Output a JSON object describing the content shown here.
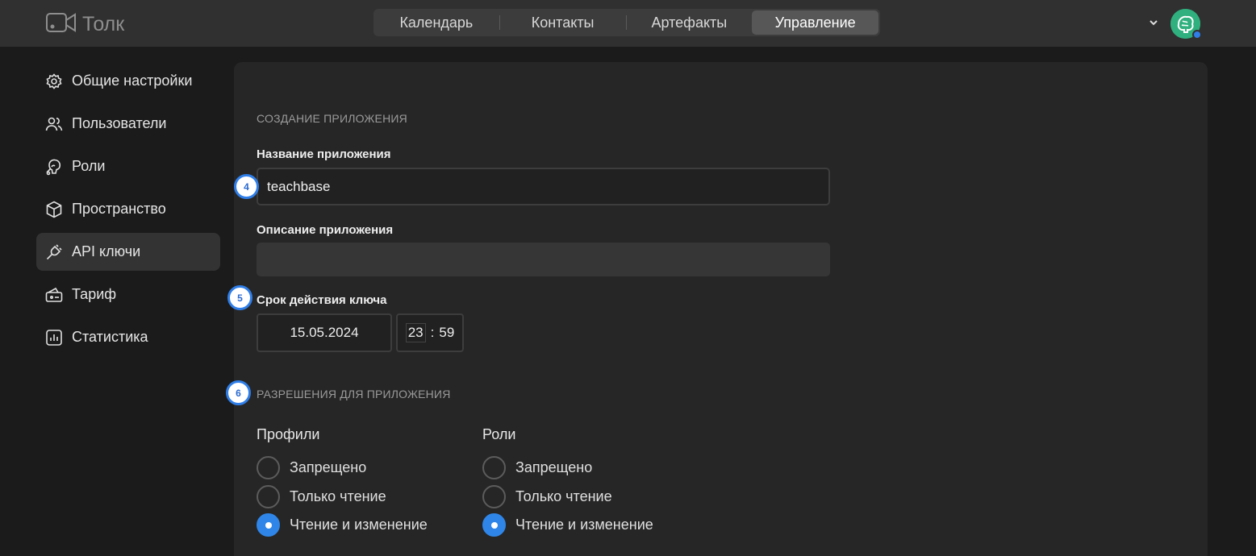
{
  "app": {
    "name": "Толк"
  },
  "nav_tabs": [
    {
      "label": "Календарь"
    },
    {
      "label": "Контакты"
    },
    {
      "label": "Артефакты"
    },
    {
      "label": "Управление"
    }
  ],
  "active_tab": "Управление",
  "sidebar": {
    "items": [
      {
        "label": "Общие настройки",
        "icon": "gear-icon"
      },
      {
        "label": "Пользователи",
        "icon": "users-icon"
      },
      {
        "label": "Роли",
        "icon": "roles-icon"
      },
      {
        "label": "Пространство",
        "icon": "cube-icon"
      },
      {
        "label": "API ключи",
        "icon": "plug-icon"
      },
      {
        "label": "Тариф",
        "icon": "tariff-icon"
      },
      {
        "label": "Статистика",
        "icon": "stats-icon"
      }
    ],
    "active": "API ключи"
  },
  "form": {
    "section_title": "СОЗДАНИЕ ПРИЛОЖЕНИЯ",
    "app_name_label": "Название приложения",
    "app_name_value": "teachbase",
    "app_desc_label": "Описание приложения",
    "app_desc_value": "",
    "expiry_label": "Срок действия ключа",
    "expiry_date": "15.05.2024",
    "expiry_hours": "23",
    "expiry_sep": ":",
    "expiry_minutes": "59",
    "permissions_title": "РАЗРЕШЕНИЯ ДЛЯ ПРИЛОЖЕНИЯ"
  },
  "badges": {
    "b4": "4",
    "b5": "5",
    "b6": "6"
  },
  "permissions": [
    {
      "group": "Профили",
      "options": [
        "Запрещено",
        "Только чтение",
        "Чтение и изменение"
      ],
      "selected": "Чтение и изменение"
    },
    {
      "group": "Роли",
      "options": [
        "Запрещено",
        "Только чтение",
        "Чтение и изменение"
      ],
      "selected": "Чтение и изменение"
    }
  ],
  "colors": {
    "accent": "#2f86e8",
    "background": "#1b1b1b",
    "panel": "#262626",
    "topbar": "#303030"
  }
}
